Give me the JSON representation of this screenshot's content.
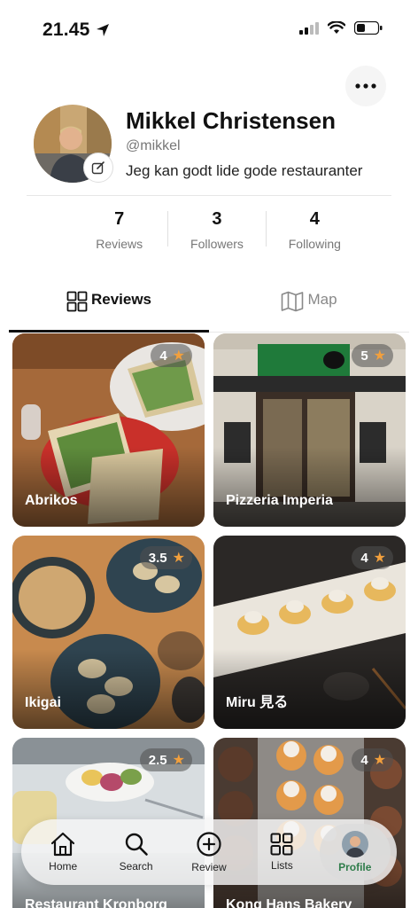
{
  "status": {
    "time": "21.45"
  },
  "profile": {
    "name": "Mikkel Christensen",
    "handle": "@mikkel",
    "bio": "Jeg kan godt lide gode restauranter"
  },
  "stats": [
    {
      "value": "7",
      "label": "Reviews"
    },
    {
      "value": "3",
      "label": "Followers"
    },
    {
      "value": "4",
      "label": "Following"
    }
  ],
  "tabs": {
    "reviews": "Reviews",
    "map": "Map",
    "active": "reviews"
  },
  "reviews": [
    {
      "name": "Abrikos",
      "rating": "4"
    },
    {
      "name": "Pizzeria Imperia",
      "rating": "5"
    },
    {
      "name": "Ikigai",
      "rating": "3.5"
    },
    {
      "name": "Miru 見る",
      "rating": "4"
    },
    {
      "name": "Restaurant Kronborg",
      "rating": "2.5"
    },
    {
      "name": "Kong Hans Bakery",
      "rating": "4"
    }
  ],
  "tabbar": {
    "home": "Home",
    "search": "Search",
    "review": "Review",
    "lists": "Lists",
    "profile": "Profile",
    "active": "profile"
  },
  "colors": {
    "accent": "#2f7d4a",
    "star": "#f2a03d"
  }
}
